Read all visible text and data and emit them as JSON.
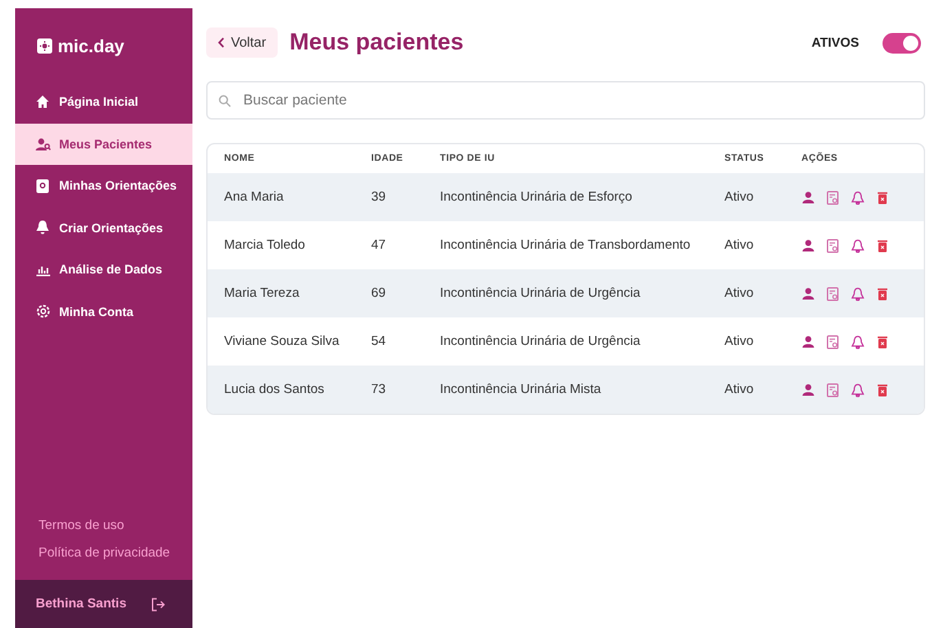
{
  "sidebar": {
    "logo": "mic.day",
    "items": [
      {
        "label": "Página Inicial",
        "selected": false
      },
      {
        "label": "Meus Pacientes",
        "selected": true
      },
      {
        "label": "Minhas Orientações",
        "selected": false
      },
      {
        "label": "Criar Orientações",
        "selected": false
      },
      {
        "label": "Análise de Dados",
        "selected": false
      },
      {
        "label": "Minha Conta",
        "selected": false
      }
    ],
    "footer_links": [
      "Termos de uso",
      "Política de privacidade"
    ],
    "user": {
      "name": "Bethina Santis"
    }
  },
  "header": {
    "back_button": "Voltar",
    "title": "Meus pacientes",
    "toggle": {
      "label": "ATIVOS",
      "on": true
    }
  },
  "search": {
    "placeholder": "Buscar paciente"
  },
  "table": {
    "columns": [
      "NOME",
      "IDADE",
      "TIPO DE IU",
      "STATUS",
      "AÇÕES"
    ],
    "rows": [
      {
        "name": "Ana Maria",
        "age": "39",
        "type": "Incontinência Urinária de Esforço",
        "status": "Ativo"
      },
      {
        "name": "Marcia Toledo",
        "age": "47",
        "type": "Incontinência Urinária de Transbordamento",
        "status": "Ativo"
      },
      {
        "name": "Maria Tereza",
        "age": "69",
        "type": "Incontinência Urinária de Urgência",
        "status": "Ativo"
      },
      {
        "name": "Viviane Souza Silva",
        "age": "54",
        "type": "Incontinência Urinária de Urgência",
        "status": "Ativo"
      },
      {
        "name": "Lucia dos Santos",
        "age": "73",
        "type": "Incontinência Urinária Mista",
        "status": "Ativo"
      }
    ]
  }
}
